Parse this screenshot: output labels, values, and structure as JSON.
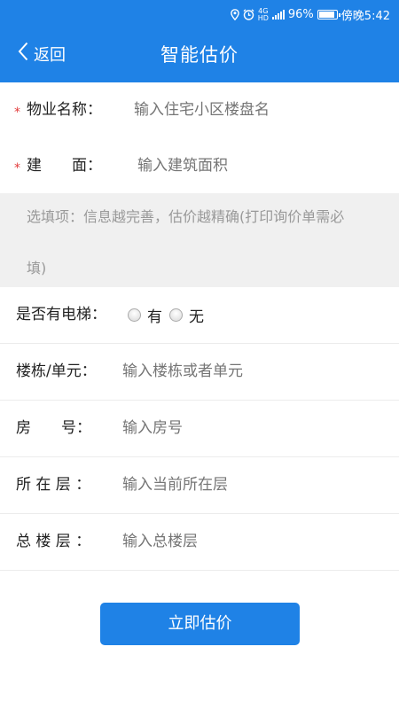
{
  "status_bar": {
    "network_top": "4G",
    "network_bottom": "HD",
    "battery_percent_text": "96%",
    "battery_level": 0.96,
    "time": "傍晚5:42"
  },
  "nav": {
    "back_label": "返回",
    "title": "智能估价"
  },
  "form": {
    "property_name": {
      "required_mark": "*",
      "label": "物业名称：",
      "placeholder": "输入住宅小区楼盘名"
    },
    "building_area": {
      "required_mark": "*",
      "label": "建　　面：",
      "placeholder": "输入建筑面积"
    },
    "notice_line1": "选填项：信息越完善，估价越精确(打印询价单需必",
    "notice_line2": "填)",
    "elevator": {
      "label": "是否有电梯：",
      "option_yes": "有",
      "option_no": "无"
    },
    "building_unit": {
      "label": "楼栋/单元：",
      "placeholder": "输入楼栋或者单元"
    },
    "room_number": {
      "label": "房　　号：",
      "placeholder": "输入房号"
    },
    "current_floor": {
      "label": "所 在 层 ：",
      "placeholder": "输入当前所在层"
    },
    "total_floors": {
      "label": "总 楼 层 ：",
      "placeholder": "输入总楼层"
    }
  },
  "submit_label": "立即估价",
  "colors": {
    "primary": "#1f82e6",
    "required": "#e23b3b",
    "notice_bg": "#f0f0f0",
    "placeholder": "#777777"
  }
}
